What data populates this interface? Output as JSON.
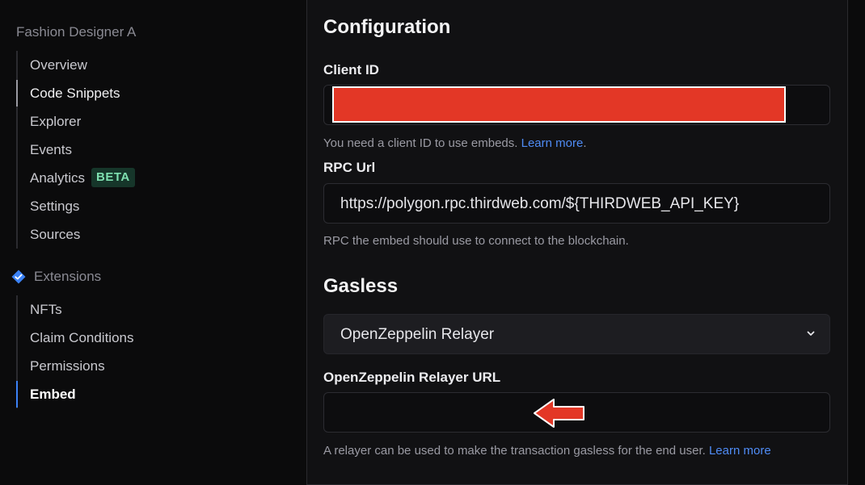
{
  "sidebar": {
    "project_title": "Fashion Designer A",
    "main_items": [
      {
        "label": "Overview"
      },
      {
        "label": "Code Snippets"
      },
      {
        "label": "Explorer"
      },
      {
        "label": "Events"
      },
      {
        "label": "Analytics",
        "badge": "BETA"
      },
      {
        "label": "Settings"
      },
      {
        "label": "Sources"
      }
    ],
    "extensions_label": "Extensions",
    "extension_items": [
      {
        "label": "NFTs"
      },
      {
        "label": "Claim Conditions"
      },
      {
        "label": "Permissions"
      },
      {
        "label": "Embed"
      }
    ]
  },
  "config": {
    "heading": "Configuration",
    "client_id": {
      "label": "Client ID",
      "help_text": "You need a client ID to use embeds. ",
      "help_link": "Learn more",
      "help_suffix": "."
    },
    "rpc": {
      "label": "RPC Url",
      "value": "https://polygon.rpc.thirdweb.com/${THIRDWEB_API_KEY}",
      "help_text": "RPC the embed should use to connect to the blockchain."
    },
    "gasless": {
      "heading": "Gasless",
      "selected": "OpenZeppelin Relayer",
      "relayer_label": "OpenZeppelin Relayer URL",
      "relayer_value": "",
      "help_text": "A relayer can be used to make the transaction gasless for the end user. ",
      "help_link": "Learn more"
    }
  },
  "colors": {
    "accent": "#3b82f6",
    "redaction": "#e33726",
    "arrow": "#e33726",
    "badge_text": "#7ee0b0"
  }
}
